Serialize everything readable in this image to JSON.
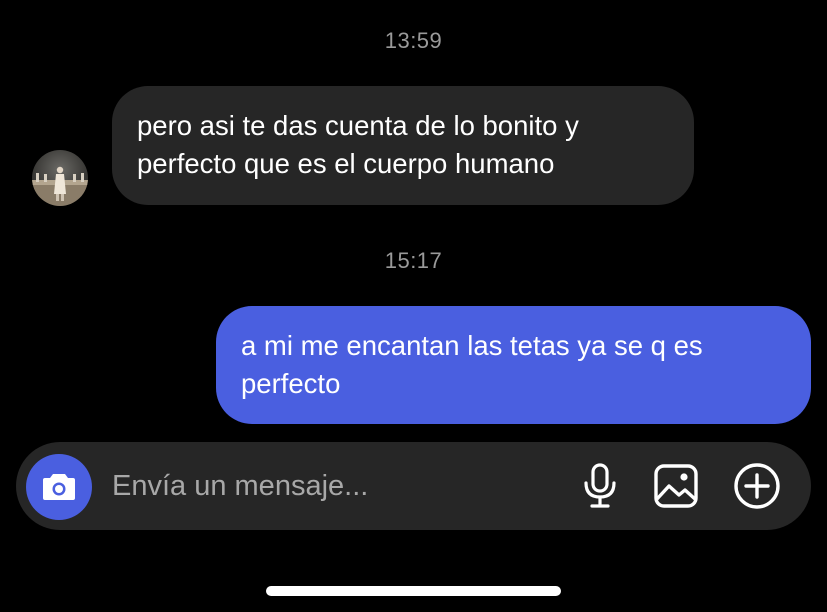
{
  "conversation": {
    "messages": [
      {
        "timestamp": "13:59",
        "direction": "incoming",
        "lines": [
          "pero asi te das cuenta de lo bonito y",
          "perfecto que es el cuerpo humano"
        ]
      },
      {
        "timestamp": "15:17",
        "direction": "outgoing",
        "lines": [
          "a mi me encantan las tetas ya se q es",
          "perfecto"
        ]
      }
    ]
  },
  "composer": {
    "placeholder": "Envía un mensaje...",
    "icons": {
      "camera": "camera-icon",
      "microphone": "microphone-icon",
      "gallery": "image-gallery-icon",
      "add": "plus-circle-icon"
    }
  },
  "colors": {
    "background": "#000000",
    "incoming_bubble": "#262626",
    "outgoing_bubble": "#4a5fe0",
    "timestamp_text": "#9a9a9a",
    "accent": "#4a5fe0"
  }
}
